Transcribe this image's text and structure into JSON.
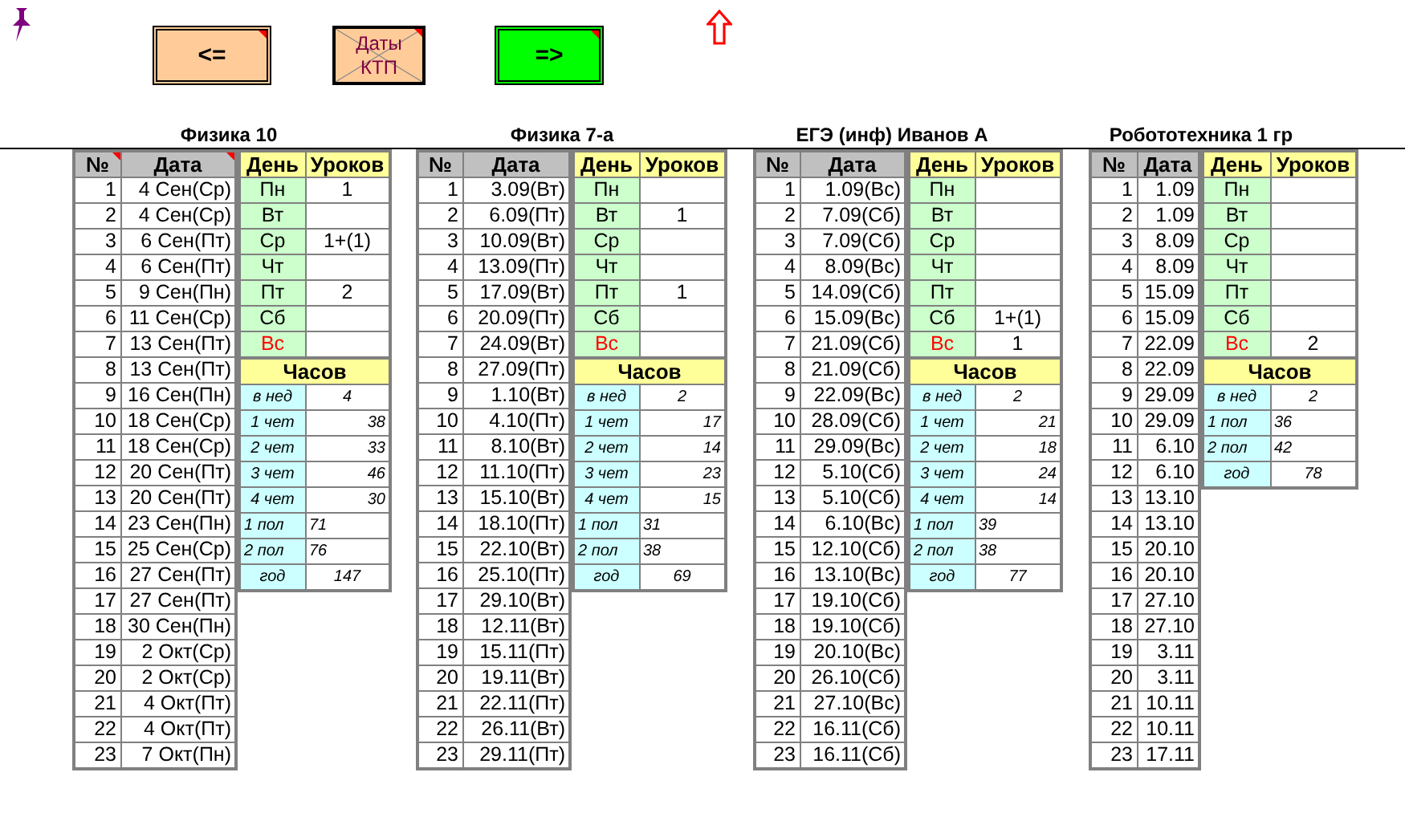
{
  "toolbar": {
    "buttons": [
      {
        "label": "<=",
        "kind": "back",
        "note": true
      },
      {
        "label": "Даты КТП",
        "kind": "crossed",
        "note": true
      },
      {
        "label": "=>",
        "kind": "forward",
        "note": true
      }
    ]
  },
  "sheets": [
    {
      "title": "Физика 10",
      "columns": [
        {
          "label": "№",
          "note": true
        },
        {
          "label": "Дата",
          "note": true
        }
      ],
      "side_columns": [
        "День",
        "Уроков"
      ],
      "rows": [
        {
          "num": "1",
          "date": "4 Сен(Ср)"
        },
        {
          "num": "2",
          "date": "4 Сен(Ср)"
        },
        {
          "num": "3",
          "date": "6 Сен(Пт)"
        },
        {
          "num": "4",
          "date": "6 Сен(Пт)"
        },
        {
          "num": "5",
          "date": "9 Сен(Пн)"
        },
        {
          "num": "6",
          "date": "11 Сен(Ср)"
        },
        {
          "num": "7",
          "date": "13 Сен(Пт)"
        },
        {
          "num": "8",
          "date": "13 Сен(Пт)"
        },
        {
          "num": "9",
          "date": "16 Сен(Пн)"
        },
        {
          "num": "10",
          "date": "18 Сен(Ср)"
        },
        {
          "num": "11",
          "date": "18 Сен(Ср)"
        },
        {
          "num": "12",
          "date": "20 Сен(Пт)"
        },
        {
          "num": "13",
          "date": "20 Сен(Пт)"
        },
        {
          "num": "14",
          "date": "23 Сен(Пн)"
        },
        {
          "num": "15",
          "date": "25 Сен(Ср)"
        },
        {
          "num": "16",
          "date": "27 Сен(Пт)"
        },
        {
          "num": "17",
          "date": "27 Сен(Пт)"
        },
        {
          "num": "18",
          "date": "30 Сен(Пн)"
        },
        {
          "num": "19",
          "date": "2 Окт(Ср)"
        },
        {
          "num": "20",
          "date": "2 Окт(Ср)"
        },
        {
          "num": "21",
          "date": "4 Окт(Пт)"
        },
        {
          "num": "22",
          "date": "4 Окт(Пт)"
        },
        {
          "num": "23",
          "date": "7 Окт(Пн)"
        }
      ],
      "days": [
        {
          "day": "Пн",
          "lessons": "1",
          "holiday": false
        },
        {
          "day": "Вт",
          "holiday": false
        },
        {
          "day": "Ср",
          "lessons": "1+(1)",
          "holiday": false
        },
        {
          "day": "Чт",
          "holiday": false
        },
        {
          "day": "Пт",
          "lessons": "2",
          "holiday": false
        },
        {
          "day": "Сб",
          "holiday": false
        },
        {
          "day": "Вс",
          "holiday": true
        }
      ],
      "hours_title": "Часов",
      "hours": [
        {
          "label": "в нед",
          "value": "4",
          "kind": "week"
        },
        {
          "label": "1 чет",
          "value": "38",
          "kind": "quarter"
        },
        {
          "label": "2 чет",
          "value": "33",
          "kind": "quarter"
        },
        {
          "label": "3 чет",
          "value": "46",
          "kind": "quarter"
        },
        {
          "label": "4 чет",
          "value": "30",
          "kind": "quarter"
        },
        {
          "label": "1 пол",
          "value": "71",
          "kind": "half"
        },
        {
          "label": "2 пол",
          "value": "76",
          "kind": "half"
        },
        {
          "label": "год",
          "value": "147",
          "kind": "year"
        }
      ]
    },
    {
      "title": "Физика 7-а",
      "columns": [
        {
          "label": "№",
          "note": false
        },
        {
          "label": "Дата",
          "note": false
        }
      ],
      "side_columns": [
        "День",
        "Уроков"
      ],
      "rows": [
        {
          "num": "1",
          "date": "3.09(Вт)"
        },
        {
          "num": "2",
          "date": "6.09(Пт)"
        },
        {
          "num": "3",
          "date": "10.09(Вт)"
        },
        {
          "num": "4",
          "date": "13.09(Пт)"
        },
        {
          "num": "5",
          "date": "17.09(Вт)"
        },
        {
          "num": "6",
          "date": "20.09(Пт)"
        },
        {
          "num": "7",
          "date": "24.09(Вт)"
        },
        {
          "num": "8",
          "date": "27.09(Пт)"
        },
        {
          "num": "9",
          "date": "1.10(Вт)"
        },
        {
          "num": "10",
          "date": "4.10(Пт)"
        },
        {
          "num": "11",
          "date": "8.10(Вт)"
        },
        {
          "num": "12",
          "date": "11.10(Пт)"
        },
        {
          "num": "13",
          "date": "15.10(Вт)"
        },
        {
          "num": "14",
          "date": "18.10(Пт)"
        },
        {
          "num": "15",
          "date": "22.10(Вт)"
        },
        {
          "num": "16",
          "date": "25.10(Пт)"
        },
        {
          "num": "17",
          "date": "29.10(Вт)"
        },
        {
          "num": "18",
          "date": "12.11(Вт)"
        },
        {
          "num": "19",
          "date": "15.11(Пт)"
        },
        {
          "num": "20",
          "date": "19.11(Вт)"
        },
        {
          "num": "21",
          "date": "22.11(Пт)"
        },
        {
          "num": "22",
          "date": "26.11(Вт)"
        },
        {
          "num": "23",
          "date": "29.11(Пт)"
        }
      ],
      "days": [
        {
          "day": "Пн",
          "holiday": false
        },
        {
          "day": "Вт",
          "lessons": "1",
          "holiday": false
        },
        {
          "day": "Ср",
          "holiday": false
        },
        {
          "day": "Чт",
          "holiday": false
        },
        {
          "day": "Пт",
          "lessons": "1",
          "holiday": false
        },
        {
          "day": "Сб",
          "holiday": false
        },
        {
          "day": "Вс",
          "holiday": true
        }
      ],
      "hours_title": "Часов",
      "hours": [
        {
          "label": "в нед",
          "value": "2",
          "kind": "week"
        },
        {
          "label": "1 чет",
          "value": "17",
          "kind": "quarter"
        },
        {
          "label": "2 чет",
          "value": "14",
          "kind": "quarter"
        },
        {
          "label": "3 чет",
          "value": "23",
          "kind": "quarter"
        },
        {
          "label": "4 чет",
          "value": "15",
          "kind": "quarter"
        },
        {
          "label": "1 пол",
          "value": "31",
          "kind": "half"
        },
        {
          "label": "2 пол",
          "value": "38",
          "kind": "half"
        },
        {
          "label": "год",
          "value": "69",
          "kind": "year"
        }
      ]
    },
    {
      "title": "ЕГЭ (инф) Иванов А",
      "columns": [
        {
          "label": "№",
          "note": false
        },
        {
          "label": "Дата",
          "note": false
        }
      ],
      "side_columns": [
        "День",
        "Уроков"
      ],
      "rows": [
        {
          "num": "1",
          "date": "1.09(Вс)"
        },
        {
          "num": "2",
          "date": "7.09(Сб)"
        },
        {
          "num": "3",
          "date": "7.09(Сб)"
        },
        {
          "num": "4",
          "date": "8.09(Вс)"
        },
        {
          "num": "5",
          "date": "14.09(Сб)"
        },
        {
          "num": "6",
          "date": "15.09(Вс)"
        },
        {
          "num": "7",
          "date": "21.09(Сб)"
        },
        {
          "num": "8",
          "date": "21.09(Сб)"
        },
        {
          "num": "9",
          "date": "22.09(Вс)"
        },
        {
          "num": "10",
          "date": "28.09(Сб)"
        },
        {
          "num": "11",
          "date": "29.09(Вс)"
        },
        {
          "num": "12",
          "date": "5.10(Сб)"
        },
        {
          "num": "13",
          "date": "5.10(Сб)"
        },
        {
          "num": "14",
          "date": "6.10(Вс)"
        },
        {
          "num": "15",
          "date": "12.10(Сб)"
        },
        {
          "num": "16",
          "date": "13.10(Вс)"
        },
        {
          "num": "17",
          "date": "19.10(Сб)"
        },
        {
          "num": "18",
          "date": "19.10(Сб)"
        },
        {
          "num": "19",
          "date": "20.10(Вс)"
        },
        {
          "num": "20",
          "date": "26.10(Сб)"
        },
        {
          "num": "21",
          "date": "27.10(Вс)"
        },
        {
          "num": "22",
          "date": "16.11(Сб)"
        },
        {
          "num": "23",
          "date": "16.11(Сб)"
        }
      ],
      "days": [
        {
          "day": "Пн",
          "holiday": false
        },
        {
          "day": "Вт",
          "holiday": false
        },
        {
          "day": "Ср",
          "holiday": false
        },
        {
          "day": "Чт",
          "holiday": false
        },
        {
          "day": "Пт",
          "holiday": false
        },
        {
          "day": "Сб",
          "lessons": "1+(1)",
          "holiday": false
        },
        {
          "day": "Вс",
          "lessons": "1",
          "holiday": true
        }
      ],
      "hours_title": "Часов",
      "hours": [
        {
          "label": "в нед",
          "value": "2",
          "kind": "week"
        },
        {
          "label": "1 чет",
          "value": "21",
          "kind": "quarter"
        },
        {
          "label": "2 чет",
          "value": "18",
          "kind": "quarter"
        },
        {
          "label": "3 чет",
          "value": "24",
          "kind": "quarter"
        },
        {
          "label": "4 чет",
          "value": "14",
          "kind": "quarter"
        },
        {
          "label": "1 пол",
          "value": "39",
          "kind": "half"
        },
        {
          "label": "2 пол",
          "value": "38",
          "kind": "half"
        },
        {
          "label": "год",
          "value": "77",
          "kind": "year"
        }
      ]
    },
    {
      "title": "Робототехника 1 гр",
      "columns": [
        {
          "label": "№",
          "note": false
        },
        {
          "label": "Дата",
          "note": false
        }
      ],
      "side_columns": [
        "День",
        "Уроков"
      ],
      "rows": [
        {
          "num": "1",
          "date": "1.09"
        },
        {
          "num": "2",
          "date": "1.09"
        },
        {
          "num": "3",
          "date": "8.09"
        },
        {
          "num": "4",
          "date": "8.09"
        },
        {
          "num": "5",
          "date": "15.09"
        },
        {
          "num": "6",
          "date": "15.09"
        },
        {
          "num": "7",
          "date": "22.09"
        },
        {
          "num": "8",
          "date": "22.09"
        },
        {
          "num": "9",
          "date": "29.09"
        },
        {
          "num": "10",
          "date": "29.09"
        },
        {
          "num": "11",
          "date": "6.10"
        },
        {
          "num": "12",
          "date": "6.10"
        },
        {
          "num": "13",
          "date": "13.10"
        },
        {
          "num": "14",
          "date": "13.10"
        },
        {
          "num": "15",
          "date": "20.10"
        },
        {
          "num": "16",
          "date": "20.10"
        },
        {
          "num": "17",
          "date": "27.10"
        },
        {
          "num": "18",
          "date": "27.10"
        },
        {
          "num": "19",
          "date": "3.11"
        },
        {
          "num": "20",
          "date": "3.11"
        },
        {
          "num": "21",
          "date": "10.11"
        },
        {
          "num": "22",
          "date": "10.11"
        },
        {
          "num": "23",
          "date": "17.11"
        }
      ],
      "days": [
        {
          "day": "Пн",
          "holiday": false
        },
        {
          "day": "Вт",
          "holiday": false
        },
        {
          "day": "Ср",
          "holiday": false
        },
        {
          "day": "Чт",
          "holiday": false
        },
        {
          "day": "Пт",
          "holiday": false
        },
        {
          "day": "Сб",
          "holiday": false
        },
        {
          "day": "Вс",
          "lessons": "2",
          "holiday": true
        }
      ],
      "hours_title": "Часов",
      "hours": [
        {
          "label": "в нед",
          "value": "2",
          "kind": "week"
        },
        {
          "label": "1 пол",
          "value": "36",
          "kind": "half"
        },
        {
          "label": "2 пол",
          "value": "42",
          "kind": "half"
        },
        {
          "label": "год",
          "value": "78",
          "kind": "year"
        }
      ]
    }
  ]
}
